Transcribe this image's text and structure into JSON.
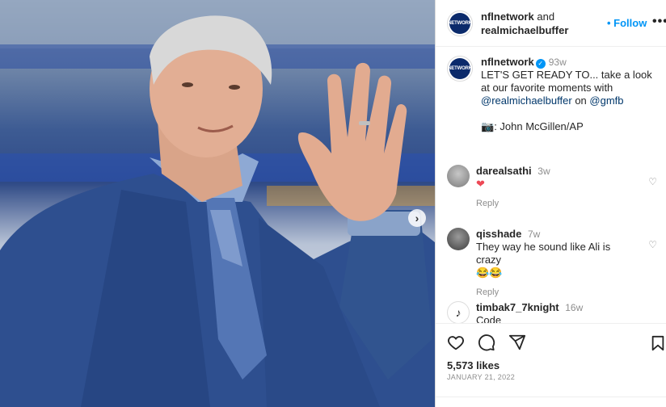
{
  "header": {
    "account1": "nflnetwork",
    "and_text": "and",
    "account2": "realmichaelbuffer",
    "follow_label": "• Follow",
    "more_label": "•••",
    "avatar_text": "NETWORK"
  },
  "caption": {
    "user": "nflnetwork",
    "verified_icon": "check-badge",
    "time": "93w",
    "line1": "LET'S GET READY TO... take a look at our favorite moments with",
    "mention": "@realmichaelbuffer",
    "on_text": "on",
    "hashtag": "@gmfb",
    "credit_icon": "camera-emoji",
    "credit": "John McGillen/AP"
  },
  "comments": [
    {
      "user": "darealsathi",
      "time": "3w",
      "text": "❤",
      "reply": "Reply"
    },
    {
      "user": "qisshade",
      "time": "7w",
      "text": "They way he sound like Ali is crazy",
      "emoji": "😂😂",
      "reply": "Reply"
    },
    {
      "user": "timbak7_7knight",
      "time": "16w",
      "text": "Code"
    }
  ],
  "footer": {
    "likes": "5,573 likes",
    "date": "JANUARY 21, 2022"
  },
  "photo": {
    "next_label": "›"
  },
  "colors": {
    "accent": "#0095f6",
    "text": "#262626",
    "muted": "#8e8e8e",
    "heart": "#ed4956"
  }
}
